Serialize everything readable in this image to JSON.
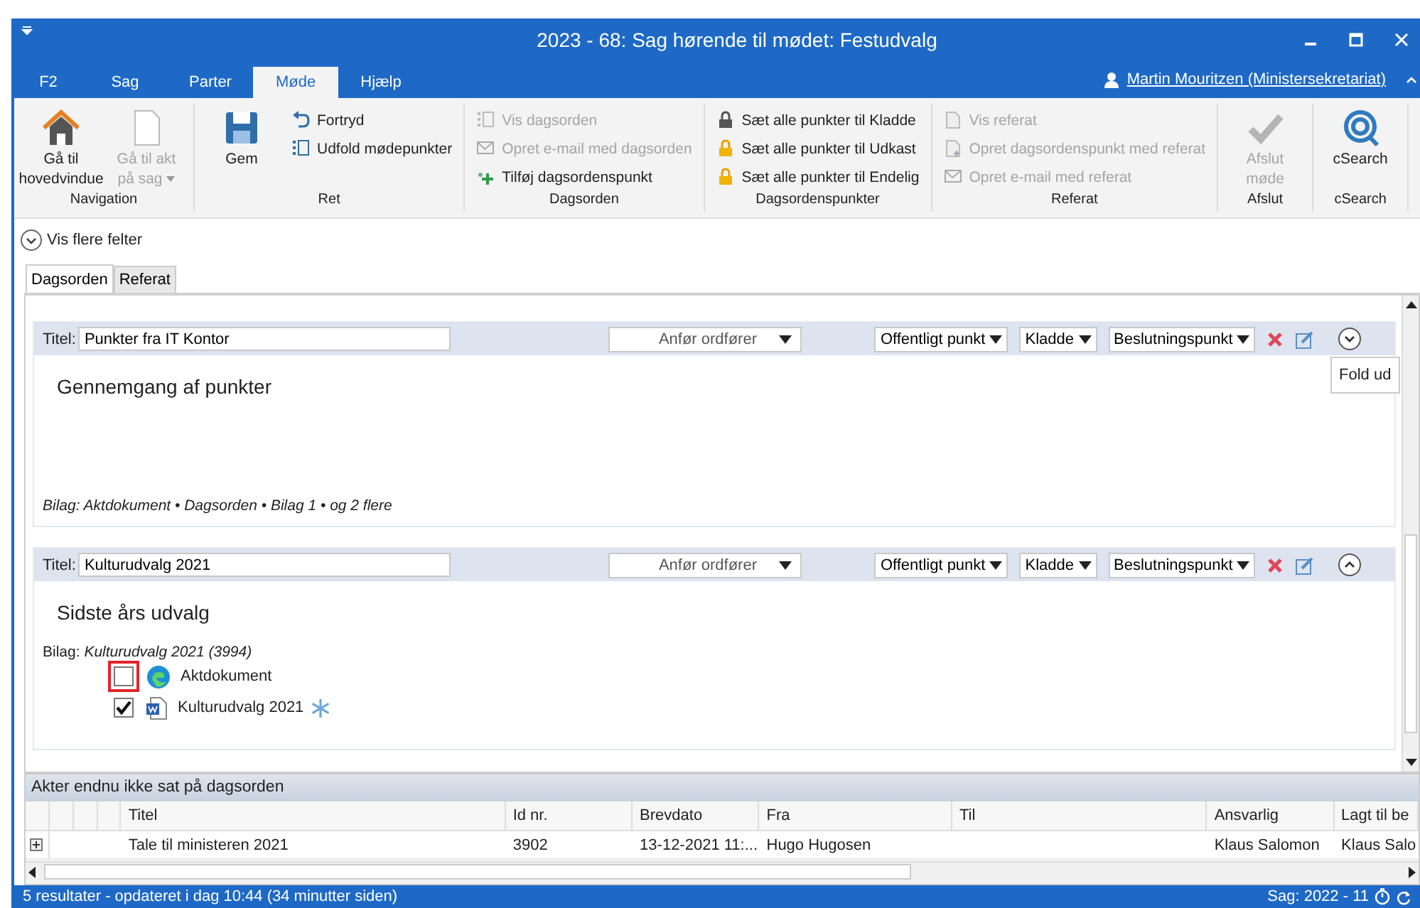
{
  "window": {
    "title": "2023 - 68: Sag hørende til mødet: Festudvalg"
  },
  "ribbon_tabs": [
    {
      "label": "F2",
      "selected": false
    },
    {
      "label": "Sag",
      "selected": false
    },
    {
      "label": "Parter",
      "selected": false
    },
    {
      "label": "Møde",
      "selected": true
    },
    {
      "label": "Hjælp",
      "selected": false
    }
  ],
  "user": "Martin Mouritzen (Ministersekretariat)",
  "ribbon_groups": [
    {
      "label": "Navigation",
      "items": [
        {
          "kind": "large",
          "label": "Gå til hovedvindue",
          "disabled": false
        },
        {
          "kind": "large",
          "label": "Gå til akt på sag",
          "disabled": true,
          "dropdown": true
        }
      ]
    },
    {
      "label": "Ret",
      "items": [
        {
          "kind": "large",
          "label": "Gem",
          "disabled": false
        },
        {
          "kind": "small",
          "label": "Fortryd",
          "disabled": false
        },
        {
          "kind": "small",
          "label": "Udfold mødepunkter",
          "disabled": false
        }
      ]
    },
    {
      "label": "Dagsorden",
      "items": [
        {
          "kind": "small",
          "label": "Vis dagsorden",
          "disabled": true
        },
        {
          "kind": "small",
          "label": "Opret e-mail med dagsorden",
          "disabled": true
        },
        {
          "kind": "small",
          "label": "Tilføj dagsordenspunkt",
          "disabled": false
        }
      ]
    },
    {
      "label": "Dagsordenspunkter",
      "items": [
        {
          "kind": "small",
          "label": "Sæt alle punkter til Kladde",
          "disabled": false
        },
        {
          "kind": "small",
          "label": "Sæt alle punkter til Udkast",
          "disabled": false
        },
        {
          "kind": "small",
          "label": "Sæt alle punkter til Endelig",
          "disabled": false
        }
      ]
    },
    {
      "label": "Referat",
      "items": [
        {
          "kind": "small",
          "label": "Vis referat",
          "disabled": true
        },
        {
          "kind": "small",
          "label": "Opret dagsordenspunkt med referat",
          "disabled": true
        },
        {
          "kind": "small",
          "label": "Opret e-mail med referat",
          "disabled": true
        }
      ]
    },
    {
      "label": "Afslut",
      "items": [
        {
          "kind": "large",
          "label": "Afslut møde",
          "disabled": true
        }
      ]
    },
    {
      "label": "cSearch",
      "items": [
        {
          "kind": "large",
          "label": "cSearch",
          "disabled": false
        }
      ]
    }
  ],
  "more_fields": "Vis flere felter",
  "content_tabs": [
    {
      "label": "Dagsorden",
      "selected": true
    },
    {
      "label": "Referat",
      "selected": false
    }
  ],
  "agenda_items": [
    {
      "title_label": "Titel:",
      "title": "Punkter fra IT Kontor",
      "rapporteur_placeholder": "Anfør ordfører",
      "dropdowns": [
        "Offentligt punkt",
        "Kladde",
        "Beslutningspunkt"
      ],
      "expanded": false,
      "heading": "Gennemgang af punkter",
      "bilag": "Bilag: Aktdokument • Dagsorden • Bilag 1 •  og 2 flere",
      "bilag_italic": true,
      "tooltip": "Fold ud"
    },
    {
      "title_label": "Titel:",
      "title": "Kulturudvalg 2021",
      "rapporteur_placeholder": "Anfør ordfører",
      "dropdowns": [
        "Offentligt punkt",
        "Kladde",
        "Beslutningspunkt"
      ],
      "expanded": true,
      "heading": "Sidste års udvalg",
      "bilag": "Bilag: *Kulturudvalg 2021 (3994)*",
      "bilag_italic": false,
      "documents": [
        {
          "kind": "web",
          "name": "Aktdokument",
          "checked": false,
          "highlighted": true,
          "snowflake": false
        },
        {
          "kind": "word",
          "name": "Kulturudvalg 2021",
          "checked": true,
          "highlighted": false,
          "snowflake": true
        }
      ]
    }
  ],
  "grid": {
    "title": "Akter endnu ikke sat på dagsorden",
    "columns": [
      "Titel",
      "Id nr.",
      "Brevdato",
      "Fra",
      "Til",
      "Ansvarlig",
      "Lagt til be"
    ],
    "rows": [
      {
        "expanded": false,
        "cells": [
          "Tale til ministeren 2021",
          "3902",
          "13-12-2021 11:...",
          "Hugo Hugosen",
          null,
          "Klaus Salomon",
          "Klaus Salo"
        ]
      }
    ]
  },
  "status_bar": {
    "left": "5 resultater - opdateret i dag 10:44 (34 minutter siden)",
    "right": "Sag: 2022 - 11"
  }
}
